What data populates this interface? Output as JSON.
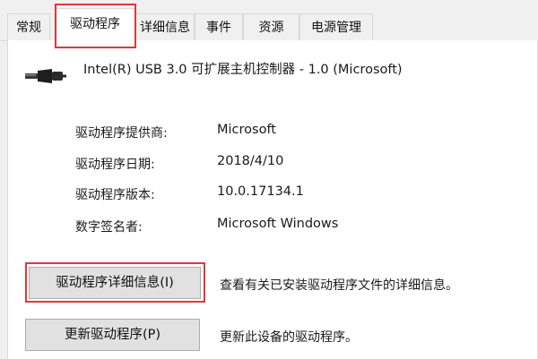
{
  "tabs": [
    {
      "label": "常规"
    },
    {
      "label": "驱动程序"
    },
    {
      "label": "详细信息"
    },
    {
      "label": "事件"
    },
    {
      "label": "资源"
    },
    {
      "label": "电源管理"
    }
  ],
  "device": {
    "icon": "usb-cable-icon",
    "name": "Intel(R) USB 3.0 可扩展主机控制器 - 1.0 (Microsoft)"
  },
  "properties": [
    {
      "label": "驱动程序提供商:",
      "value": "Microsoft"
    },
    {
      "label": "驱动程序日期:",
      "value": "2018/4/10"
    },
    {
      "label": "驱动程序版本:",
      "value": "10.0.17134.1"
    },
    {
      "label": "数字签名者:",
      "value": "Microsoft Windows"
    }
  ],
  "buttons": [
    {
      "label": "驱动程序详细信息(I)",
      "description": "查看有关已安装驱动程序文件的详细信息。"
    },
    {
      "label": "更新驱动程序(P)",
      "description": "更新此设备的驱动程序。"
    }
  ],
  "colors": {
    "highlight": "#d93a3a",
    "panel_bg": "#ffffff",
    "window_bg": "#f0f0f0",
    "button_bg": "#e1e1e1"
  }
}
